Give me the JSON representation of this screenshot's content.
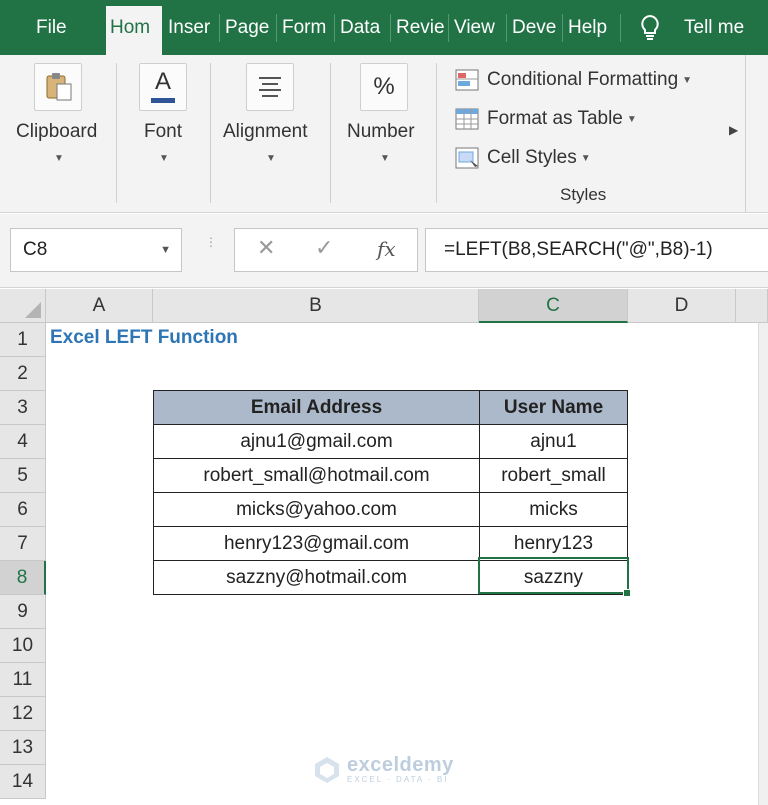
{
  "tabs": [
    {
      "label": "File",
      "active": false
    },
    {
      "label": "Hom",
      "active": true
    },
    {
      "label": "Inser",
      "active": false
    },
    {
      "label": "Page",
      "active": false
    },
    {
      "label": "Form",
      "active": false
    },
    {
      "label": "Data",
      "active": false
    },
    {
      "label": "Revie",
      "active": false
    },
    {
      "label": "View",
      "active": false
    },
    {
      "label": "Deve",
      "active": false
    },
    {
      "label": "Help",
      "active": false
    }
  ],
  "tell_me": "Tell me",
  "ribbon": {
    "clipboard": "Clipboard",
    "font": "Font",
    "alignment": "Alignment",
    "number": "Number",
    "number_icon": "%",
    "font_icon": "A",
    "conditional_formatting": "Conditional Formatting",
    "format_as_table": "Format as Table",
    "cell_styles": "Cell Styles",
    "styles_group": "Styles"
  },
  "formula_bar": {
    "name_box": "C8",
    "fx": "fx",
    "formula": "=LEFT(B8,SEARCH(\"@\",B8)-1)"
  },
  "grid": {
    "columns": [
      "A",
      "B",
      "C",
      "D"
    ],
    "selected_column": "C",
    "rows": [
      "1",
      "2",
      "3",
      "4",
      "5",
      "6",
      "7",
      "8",
      "9",
      "10",
      "11",
      "12",
      "13",
      "14"
    ],
    "selected_row": "8",
    "title": "Excel LEFT Function",
    "table": {
      "headers": [
        "Email Address",
        "User Name"
      ],
      "rows": [
        [
          "ajnu1@gmail.com",
          "ajnu1"
        ],
        [
          "robert_small@hotmail.com",
          "robert_small"
        ],
        [
          "micks@yahoo.com",
          "micks"
        ],
        [
          "henry123@gmail.com",
          "henry123"
        ],
        [
          "sazzny@hotmail.com",
          "sazzny"
        ]
      ]
    }
  },
  "watermark": {
    "name": "exceldemy",
    "tagline": "EXCEL · DATA · BI"
  },
  "colors": {
    "excel_green": "#217346",
    "header_fill": "#acb9ca",
    "title_blue": "#2e75b6"
  }
}
